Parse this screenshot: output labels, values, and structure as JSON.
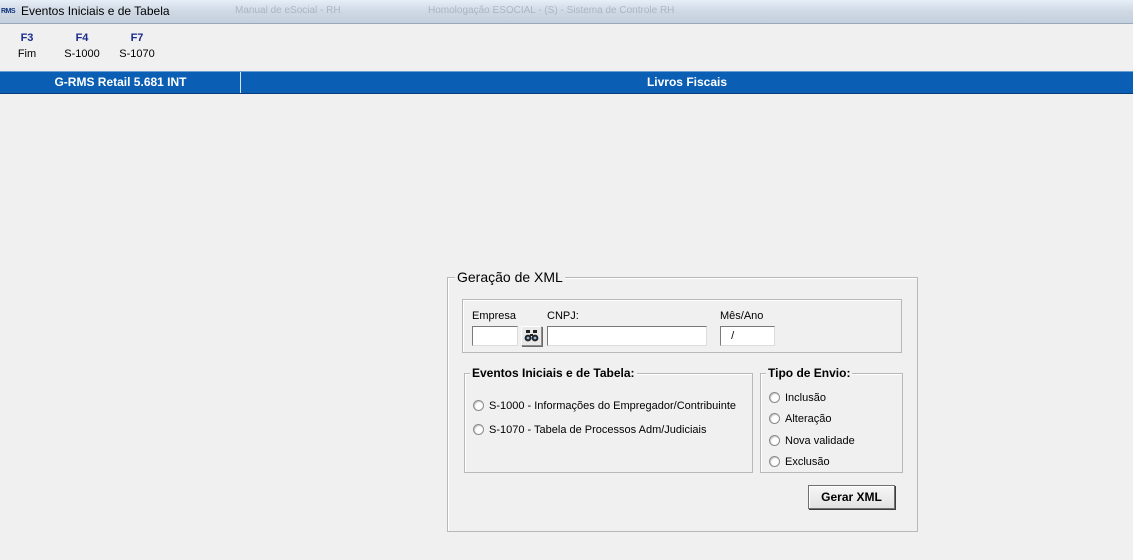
{
  "window": {
    "title": "Eventos Iniciais e de Tabela",
    "logo_text": "RMS"
  },
  "taskbar_ghost": [
    "Manual de eSocial - RH",
    "Homologação ESOCIAL - (S) - Sistema de Controle RH"
  ],
  "function_keys": [
    {
      "key": "F3",
      "label": "Fim"
    },
    {
      "key": "F4",
      "label": "S-1000"
    },
    {
      "key": "F7",
      "label": "S-1070"
    }
  ],
  "app_bar": {
    "system": "G-RMS Retail 5.681 INT",
    "module": "Livros Fiscais"
  },
  "form": {
    "title": "Geração de XML",
    "fields": {
      "empresa_label": "Empresa",
      "empresa_value": "",
      "cnpj_label": "CNPJ:",
      "cnpj_value": "",
      "mes_ano_label": "Mês/Ano",
      "mes_ano_value": "  /"
    },
    "eventos": {
      "title": "Eventos Iniciais e de Tabela:",
      "options": [
        "S-1000 - Informações do Empregador/Contribuinte",
        "S-1070 - Tabela de Processos Adm/Judiciais"
      ]
    },
    "tipo_envio": {
      "title": "Tipo de Envio:",
      "options": [
        "Inclusão",
        "Alteração",
        "Nova validade",
        "Exclusão"
      ]
    },
    "gerar_button": "Gerar XML"
  }
}
